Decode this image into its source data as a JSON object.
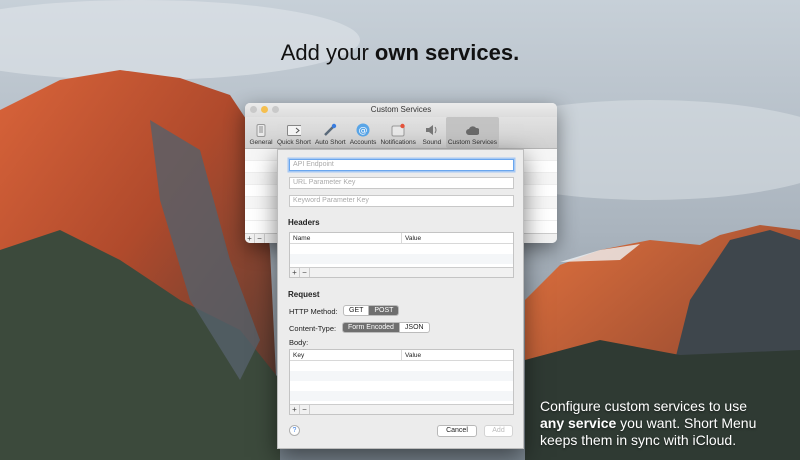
{
  "headline": {
    "prefix": "Add your ",
    "bold": "own services."
  },
  "caption": {
    "line1": "Configure custom services to use",
    "bold": "any service",
    "line2": " you want. Short Menu keeps them in sync with iCloud."
  },
  "prefs_window": {
    "title": "Custom Services",
    "toolbar": [
      {
        "label": "General",
        "icon": "phone-icon"
      },
      {
        "label": "Quick Short",
        "icon": "keyboard-icon"
      },
      {
        "label": "Auto Short",
        "icon": "wand-icon"
      },
      {
        "label": "Accounts",
        "icon": "at-icon"
      },
      {
        "label": "Notifications",
        "icon": "notification-icon"
      },
      {
        "label": "Sound",
        "icon": "speaker-icon"
      },
      {
        "label": "Custom Services",
        "icon": "cloud-icon"
      }
    ],
    "add_label": "+",
    "remove_label": "−"
  },
  "sheet": {
    "api_endpoint_placeholder": "API Endpoint",
    "url_param_placeholder": "URL Parameter Key",
    "keyword_param_placeholder": "Keyword Parameter Key",
    "headers_title": "Headers",
    "headers_columns": [
      "Name",
      "Value"
    ],
    "request_title": "Request",
    "http_method_label": "HTTP Method:",
    "http_methods": [
      "GET",
      "POST"
    ],
    "http_method_selected": "POST",
    "content_type_label": "Content-Type:",
    "content_types": [
      "Form Encoded",
      "JSON"
    ],
    "content_type_selected": "Form Encoded",
    "body_label": "Body:",
    "body_columns": [
      "Key",
      "Value"
    ],
    "add_label": "+",
    "remove_label": "−",
    "help_label": "?",
    "cancel_label": "Cancel",
    "add_button_label": "Add"
  },
  "colors": {
    "accent": "#3a7de0",
    "focus_ring": "#a7c9f3",
    "segment_selected": "#6f6f6f"
  }
}
